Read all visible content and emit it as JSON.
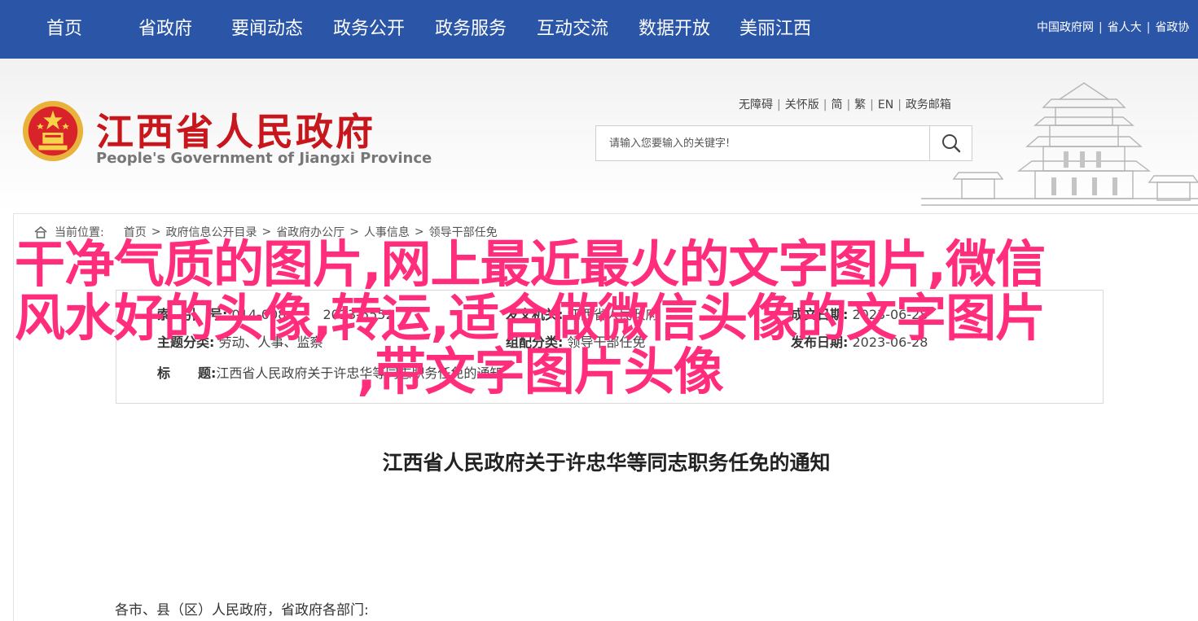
{
  "topnav": {
    "items": [
      "首页",
      "省政府",
      "要闻动态",
      "政务公开",
      "政务服务",
      "互动交流",
      "数据开放",
      "美丽江西"
    ],
    "right_links": [
      "中国政府网",
      "省人大",
      "省政协"
    ]
  },
  "header": {
    "title": "江西省人民政府",
    "subtitle": "People's Government of Jiangxi Province",
    "util_links": [
      "无障碍",
      "关怀版",
      "简",
      "繁",
      "EN",
      "政务邮箱"
    ],
    "search_placeholder": "请输入您要输入的关键字!"
  },
  "breadcrumb": {
    "label": "当前位置:",
    "items": [
      "首页",
      "政府信息公开目录",
      "省政府办公厅",
      "人事信息",
      "领导干部任免"
    ]
  },
  "meta": {
    "index_label": "索　引　号:",
    "index_value": "014-008",
    "index_extra": "2023-5552",
    "publisher_label": "发文机关:",
    "publisher_value": "江西省人民政府",
    "date_label": "成文日期:",
    "date_value": "2023-06-28",
    "topic_label": "主题分类:",
    "topic_value": "劳动、人事、监察",
    "group_label": "组配分类:",
    "group_value": "领导干部任免",
    "pubdate_label": "发布日期:",
    "pubdate_value": "2023-06-28",
    "subject_label_a": "标",
    "subject_label_b": "题:",
    "subject_value": "江西省人民政府关于许忠华等同志职务任免的通知"
  },
  "document": {
    "title": "江西省人民政府关于许忠华等同志职务任免的通知",
    "salutation": "各市、县（区）人民政府，省政府各部门:"
  },
  "overlay": {
    "line1": "干净气质的图片,网上最近最火的文字图片,微信",
    "line2": "风水好的头像,转运,适合做微信头像的文字图片",
    "line3": ",带文字图片头像"
  }
}
